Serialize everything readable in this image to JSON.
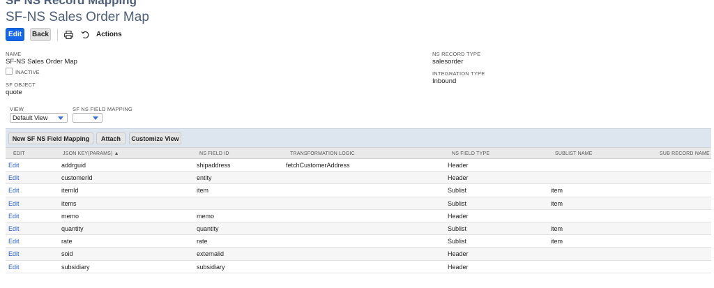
{
  "header": {
    "record_type": "SF NS Record Mapping",
    "title": "SF-NS Sales Order Map"
  },
  "toolbar": {
    "edit_label": "Edit",
    "back_label": "Back",
    "print_icon": "print-icon",
    "refresh_icon": "refresh-icon",
    "actions_label": "Actions"
  },
  "fields": {
    "name_label": "NAME",
    "name_value": "SF-NS Sales Order Map",
    "inactive_label": "INACTIVE",
    "inactive_checked": false,
    "sf_object_label": "SF OBJECT",
    "sf_object_value": "quote",
    "ns_record_type_label": "NS RECORD TYPE",
    "ns_record_type_value": "salesorder",
    "integration_type_label": "INTEGRATION TYPE",
    "integration_type_value": "Inbound"
  },
  "filters": {
    "view_label": "VIEW",
    "view_value": "Default View",
    "mapping_label": "SF NS FIELD MAPPING",
    "mapping_value": ""
  },
  "sublist": {
    "new_button": "New SF NS Field Mapping",
    "attach_button": "Attach",
    "customize_button": "Customize View",
    "columns": {
      "edit": "EDIT",
      "json_key": "JSON KEY(PARAMS) ▲",
      "ns_field_id": "NS FIELD ID",
      "transformation": "TRANSFORMATION LOGIC",
      "ns_field_type": "NS FIELD TYPE",
      "sublist_name": "SUBLIST NAME",
      "sub_record_name": "SUB RECORD NAME"
    },
    "rows": [
      {
        "edit": "Edit",
        "json_key": "addrguid",
        "ns_field_id": "shipaddress",
        "transformation": "fetchCustomerAddress",
        "ns_field_type": "Header",
        "sublist_name": "",
        "sub_record_name": ""
      },
      {
        "edit": "Edit",
        "json_key": "customerId",
        "ns_field_id": "entity",
        "transformation": "",
        "ns_field_type": "Header",
        "sublist_name": "",
        "sub_record_name": ""
      },
      {
        "edit": "Edit",
        "json_key": "itemId",
        "ns_field_id": "item",
        "transformation": "",
        "ns_field_type": "Sublist",
        "sublist_name": "item",
        "sub_record_name": ""
      },
      {
        "edit": "Edit",
        "json_key": "items",
        "ns_field_id": "",
        "transformation": "",
        "ns_field_type": "Sublist",
        "sublist_name": "item",
        "sub_record_name": ""
      },
      {
        "edit": "Edit",
        "json_key": "memo",
        "ns_field_id": "memo",
        "transformation": "",
        "ns_field_type": "Header",
        "sublist_name": "",
        "sub_record_name": ""
      },
      {
        "edit": "Edit",
        "json_key": "quantity",
        "ns_field_id": "quantity",
        "transformation": "",
        "ns_field_type": "Sublist",
        "sublist_name": "item",
        "sub_record_name": ""
      },
      {
        "edit": "Edit",
        "json_key": "rate",
        "ns_field_id": "rate",
        "transformation": "",
        "ns_field_type": "Sublist",
        "sublist_name": "item",
        "sub_record_name": ""
      },
      {
        "edit": "Edit",
        "json_key": "soid",
        "ns_field_id": "externalid",
        "transformation": "",
        "ns_field_type": "Header",
        "sublist_name": "",
        "sub_record_name": ""
      },
      {
        "edit": "Edit",
        "json_key": "subsidiary",
        "ns_field_id": "subsidiary",
        "transformation": "",
        "ns_field_type": "Header",
        "sublist_name": "",
        "sub_record_name": ""
      }
    ]
  },
  "colors": {
    "primary": "#1467e8",
    "link": "#2b62c9",
    "title": "#4d5f79",
    "sublist_bar": "#dde5ef"
  }
}
